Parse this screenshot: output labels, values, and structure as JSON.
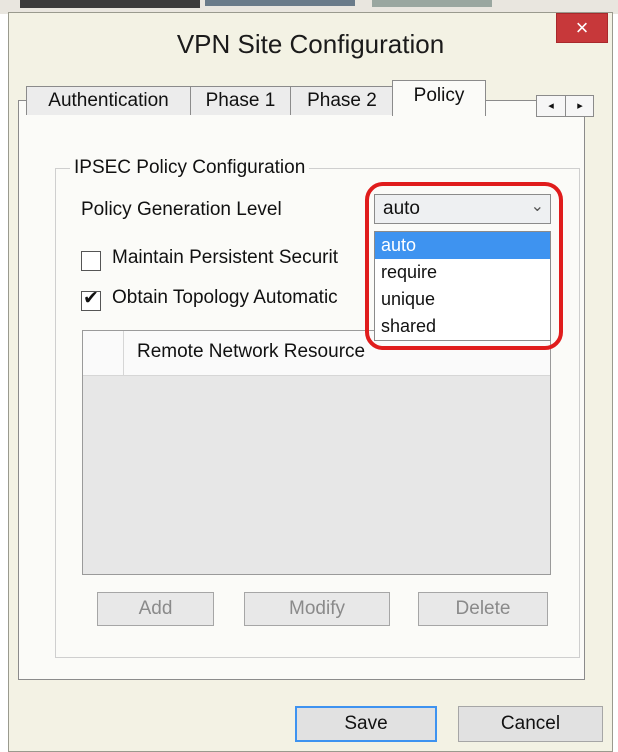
{
  "window": {
    "title": "VPN Site Configuration",
    "close_glyph": "×"
  },
  "tabs": [
    {
      "label": "Authentication",
      "active": false
    },
    {
      "label": "Phase 1",
      "active": false
    },
    {
      "label": "Phase 2",
      "active": false
    },
    {
      "label": "Policy",
      "active": true
    }
  ],
  "tab_scroll": {
    "left": "◂",
    "right": "▸"
  },
  "group": {
    "label": "IPSEC Policy Configuration"
  },
  "policy_level": {
    "label": "Policy Generation Level",
    "selected": "auto",
    "chevron": "⌵",
    "options": [
      "auto",
      "require",
      "unique",
      "shared"
    ],
    "highlighted_index": 0
  },
  "checkboxes": [
    {
      "label": "Maintain Persistent Securit",
      "checked": false
    },
    {
      "label": "Obtain Topology Automatic",
      "checked": true
    }
  ],
  "checkmark_glyph": "✔",
  "list": {
    "column": "Remote Network Resource"
  },
  "list_buttons": {
    "add": "Add",
    "modify": "Modify",
    "delete": "Delete"
  },
  "footer": {
    "save": "Save",
    "cancel": "Cancel"
  },
  "colors": {
    "highlight": "#3e93f0",
    "callout": "#e01c1c",
    "close": "#c7383a"
  }
}
